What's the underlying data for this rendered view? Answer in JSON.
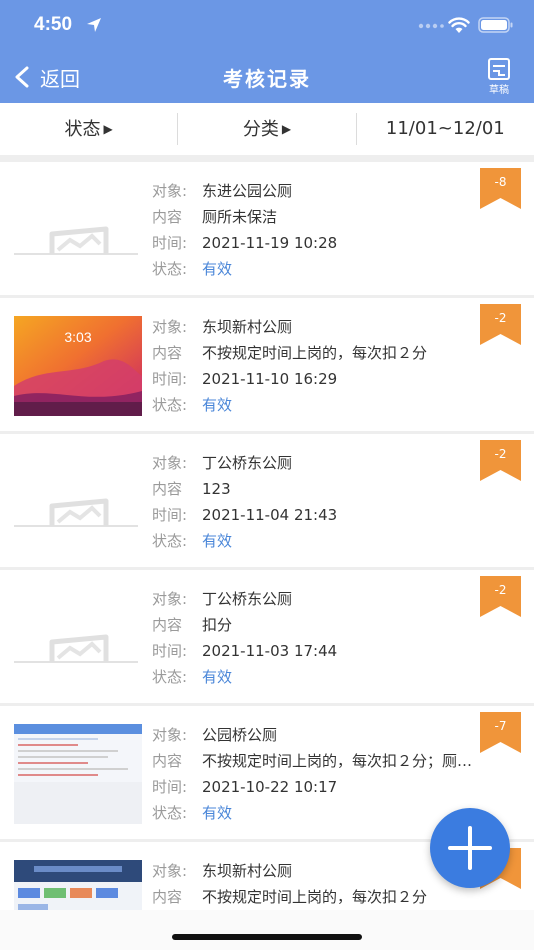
{
  "status_bar": {
    "time": "4:50"
  },
  "nav": {
    "back_label": "返回",
    "title": "考核记录",
    "draft_label": "草稿"
  },
  "filters": [
    {
      "label": "状态",
      "has_arrow": true
    },
    {
      "label": "分类",
      "has_arrow": true
    },
    {
      "label": "11/01~12/01",
      "has_arrow": false
    }
  ],
  "labels": {
    "object": "对象:",
    "content": "内容",
    "time": "时间:",
    "status": "状态:"
  },
  "records": [
    {
      "object": "东进公园公厕",
      "content": "厕所未保洁",
      "time": "2021-11-19 10:28",
      "status": "有效",
      "score": "-8",
      "thumb": "placeholder-image-icon"
    },
    {
      "object": "东坝新村公厕",
      "content": "不按规定时间上岗的，每次扣２分",
      "time": "2021-11-10 16:29",
      "status": "有效",
      "score": "-2",
      "thumb": "phone-screenshot-photo",
      "thumb_text": "3:03"
    },
    {
      "object": "丁公桥东公厕",
      "content": "123",
      "time": "2021-11-04 21:43",
      "status": "有效",
      "score": "-2",
      "thumb": "placeholder-image-icon"
    },
    {
      "object": "丁公桥东公厕",
      "content": "扣分",
      "time": "2021-11-03 17:44",
      "status": "有效",
      "score": "-2",
      "thumb": "placeholder-image-icon"
    },
    {
      "object": "公园桥公厕",
      "content": "不按规定时间上岗的，每次扣２分；厕…",
      "time": "2021-10-22 10:17",
      "status": "有效",
      "score": "-7",
      "thumb": "app-screenshot-photo"
    },
    {
      "object": "东坝新村公厕",
      "content": "不按规定时间上岗的，每次扣２分",
      "time": "",
      "status": "",
      "score": "-2",
      "thumb": "dashboard-screenshot-photo"
    }
  ],
  "colors": {
    "header": "#6b97e5",
    "ribbon": "#f0953a",
    "status_valid": "#4a86d8",
    "fab": "#3b7ce0"
  },
  "icons": {
    "back": "chevron-left-icon",
    "draft": "draft-document-icon",
    "fab": "plus-icon",
    "location": "location-arrow-icon",
    "wifi": "wifi-icon",
    "battery": "battery-icon"
  }
}
